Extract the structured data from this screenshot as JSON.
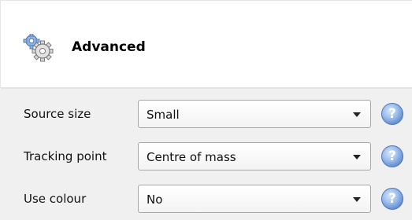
{
  "header": {
    "title": "Advanced",
    "icon": "gears-icon"
  },
  "settings": [
    {
      "label": "Source size",
      "value": "Small"
    },
    {
      "label": "Tracking point",
      "value": "Centre of mass"
    },
    {
      "label": "Use colour",
      "value": "No"
    }
  ],
  "help": {
    "symbol": "?",
    "icon": "help-icon"
  },
  "colors": {
    "help_blue": "#5b86cf",
    "background": "#f0f0f0"
  }
}
